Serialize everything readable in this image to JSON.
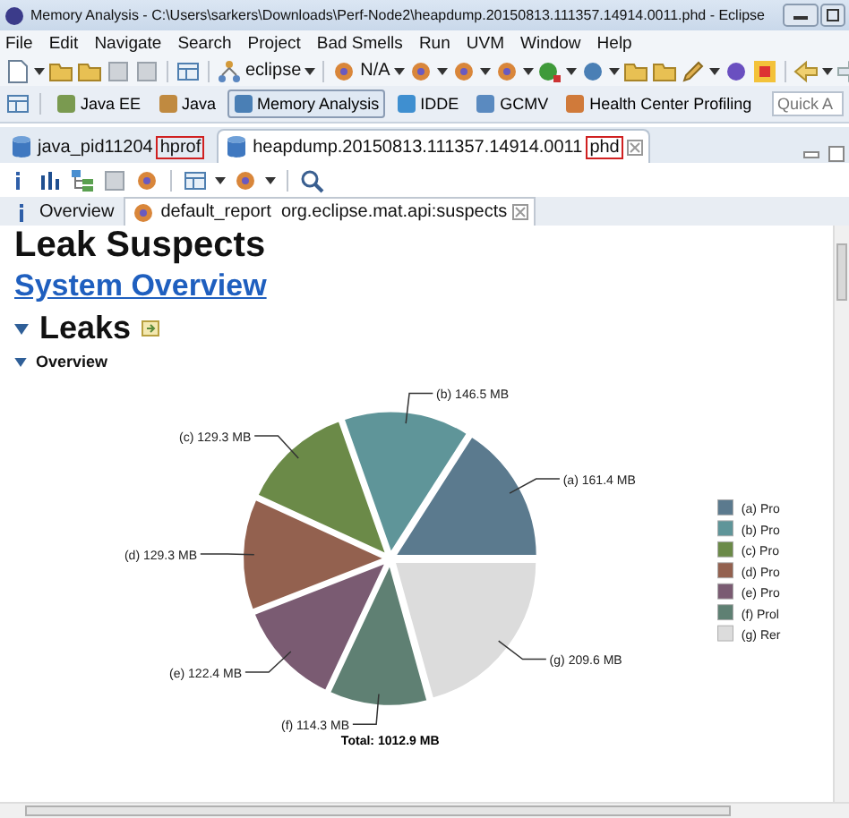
{
  "window": {
    "title": "Memory Analysis - C:\\Users\\sarkers\\Downloads\\Perf-Node2\\heapdump.20150813.111357.14914.0011.phd - Eclipse"
  },
  "menu": [
    "File",
    "Edit",
    "Navigate",
    "Search",
    "Project",
    "Bad Smells",
    "Run",
    "UVM",
    "Window",
    "Help"
  ],
  "toolbar": {
    "workspace": "eclipse",
    "status": "N/A"
  },
  "perspectives": [
    {
      "label": "Java EE",
      "selected": false
    },
    {
      "label": "Java",
      "selected": false
    },
    {
      "label": "Memory Analysis",
      "selected": true
    },
    {
      "label": "IDDE",
      "selected": false
    },
    {
      "label": "GCMV",
      "selected": false
    },
    {
      "label": "Health Center Profiling",
      "selected": false
    }
  ],
  "quick_access": {
    "placeholder": "Quick A"
  },
  "editor_tabs": [
    {
      "label": "java_pid11204",
      "extension": "hprof",
      "selected": false,
      "closable": false
    },
    {
      "label": "heapdump.20150813.111357.14914.0011",
      "extension": "phd",
      "selected": true,
      "closable": true
    }
  ],
  "report_tabs": [
    {
      "label": "Overview",
      "selected": false,
      "closable": false
    },
    {
      "label": "default_report  org.eclipse.mat.api:suspects",
      "selected": true,
      "closable": true
    }
  ],
  "report": {
    "heading": "Leak Suspects",
    "link": "System Overview",
    "section": {
      "title": "Leaks",
      "expanded": true
    },
    "subsection": {
      "title": "Overview",
      "expanded": true
    },
    "chart_data": {
      "type": "pie",
      "categories": [
        "(a) Pro",
        "(b) Pro",
        "(c) Pro",
        "(d) Pro",
        "(e) Pro",
        "(f) Prol",
        "(g) Rer"
      ],
      "values": [
        161.4,
        146.5,
        129.3,
        129.3,
        122.4,
        114.3,
        209.6
      ],
      "legend": "right",
      "colors": [
        "#5b7a8e",
        "#5f9599",
        "#6b8a48",
        "#93614f",
        "#7a5b72",
        "#5f8073",
        "#dcdcdc"
      ],
      "value_labels": [
        "(a)  161.4 MB",
        "(b)  146.5 MB",
        "(c)  129.3 MB",
        "(d)  129.3 MB",
        "(e)  122.4 MB",
        "(f)  114.3 MB",
        "(g)  209.6 MB"
      ]
    },
    "total": "Total: 1012.9 MB"
  }
}
